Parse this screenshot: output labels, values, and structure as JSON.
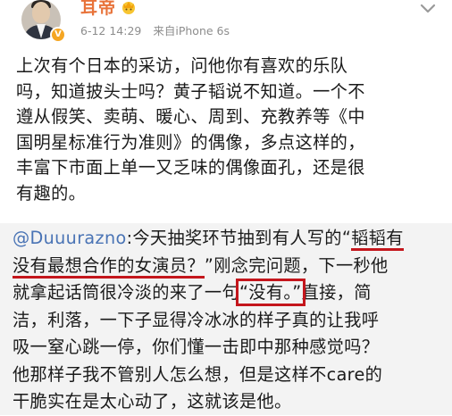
{
  "post": {
    "author": {
      "name": "耳帝",
      "badge_icon": "crown-emoji-icon",
      "verified_icon": "verified-v-icon",
      "accent": "#e8733a"
    },
    "date": "6-12 14:29",
    "source": "来自iPhone 6s",
    "lines": [
      "上次有个日本的采访，问他你有喜欢的乐队",
      "吗，知道披头士吗？黄子韬说不知道。一个不",
      "遵从假笑、卖萌、暖心、周到、充教养等《中",
      "国明星标准行为准则》的偶像，多点这样的，",
      "丰富下市面上单一又乏味的偶像面孔，还是很",
      "有趣的。"
    ]
  },
  "repost": {
    "mention": "@Duuurazno",
    "line1_rest": ":今天抽奖环节抽到有人写的",
    "line1_quote_open": "“",
    "line1_highlight": "韬韬有",
    "line2_highlight": "没有最想合作的女演员？",
    "line2_rest": "”刚念完问题，下一秒他",
    "line3_before": "就拿起话筒很冷淡的来了一句",
    "line3_box": "“没有。”",
    "line3_after": "直接，简",
    "line4": "洁，利落，一下子显得冷冰冰的样子真的让我呼",
    "line5": "吸一窒心跳一停，你们懂一击即中那种感觉吗？",
    "line6": "他那样子我不管别人怎么想，但是这样不care的",
    "line7": "干脆实在是太心动了，这就该是他。",
    "annotation_color": "#c4161c",
    "mention_color": "#4a74b5"
  },
  "ui": {
    "expand_icon": "chevron-down-icon"
  }
}
